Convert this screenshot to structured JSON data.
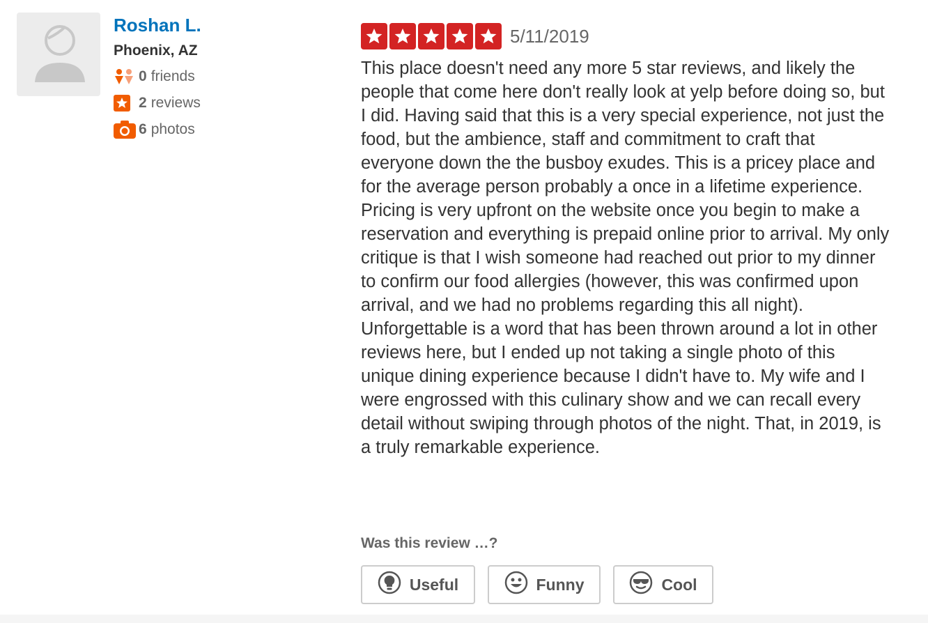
{
  "user": {
    "name": "Roshan L.",
    "location": "Phoenix, AZ",
    "stats": [
      {
        "icon": "friends-icon",
        "count": "0",
        "label": "friends"
      },
      {
        "icon": "reviews-star-icon",
        "count": "2",
        "label": "reviews"
      },
      {
        "icon": "camera-icon",
        "count": "6",
        "label": "photos"
      }
    ]
  },
  "review": {
    "rating": 5,
    "date": "5/11/2019",
    "text": "This place doesn't need any more 5 star reviews, and likely the people that come here don't really look at yelp before doing so, but I did. Having said that this is a very special experience, not just the food, but the ambience, staff and commitment to craft that everyone down the the busboy exudes. This is a pricey place and for the average person probably a once in a lifetime experience. Pricing is very upfront on the website once you begin to make a reservation and everything is prepaid online prior to arrival. My only critique is that I wish someone had reached out prior to my dinner to confirm our food allergies (however, this was confirmed upon arrival, and we had no problems regarding this all night). Unforgettable is a word that has been thrown around a lot in other reviews here, but I ended up not taking a single photo of this unique dining experience because I didn't have to. My wife and I were engrossed with this culinary show and we can recall every detail without swiping through photos of the night. That, in 2019, is a truly remarkable experience."
  },
  "votes": {
    "title": "Was this review …?",
    "useful_label": "Useful",
    "funny_label": "Funny",
    "cool_label": "Cool"
  },
  "colors": {
    "accent": "#d32323",
    "link": "#0073bb",
    "orange": "#f15c00"
  }
}
